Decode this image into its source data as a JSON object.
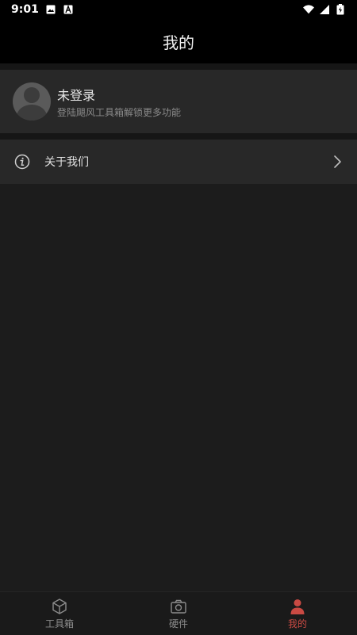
{
  "status_bar": {
    "time": "9:01",
    "left_icons": [
      "image-icon",
      "a-icon"
    ],
    "right_icons": [
      "wifi-icon",
      "signal-icon",
      "battery-icon"
    ]
  },
  "header": {
    "title": "我的"
  },
  "profile": {
    "name": "未登录",
    "subtitle": "登陆飓风工具箱解锁更多功能",
    "avatar": "avatar-placeholder-icon"
  },
  "menu": {
    "items": [
      {
        "label": "关于我们",
        "icon": "info-icon",
        "trailing_icon": "chevron-right-icon"
      }
    ]
  },
  "bottom_nav": {
    "items": [
      {
        "label": "工具箱",
        "icon": "box-icon",
        "active": false
      },
      {
        "label": "硬件",
        "icon": "camera-icon",
        "active": false
      },
      {
        "label": "我的",
        "icon": "person-icon",
        "active": true
      }
    ]
  },
  "colors": {
    "accent": "#c94a43",
    "background": "#1c1c1c",
    "card": "#282828",
    "header": "#000000"
  }
}
